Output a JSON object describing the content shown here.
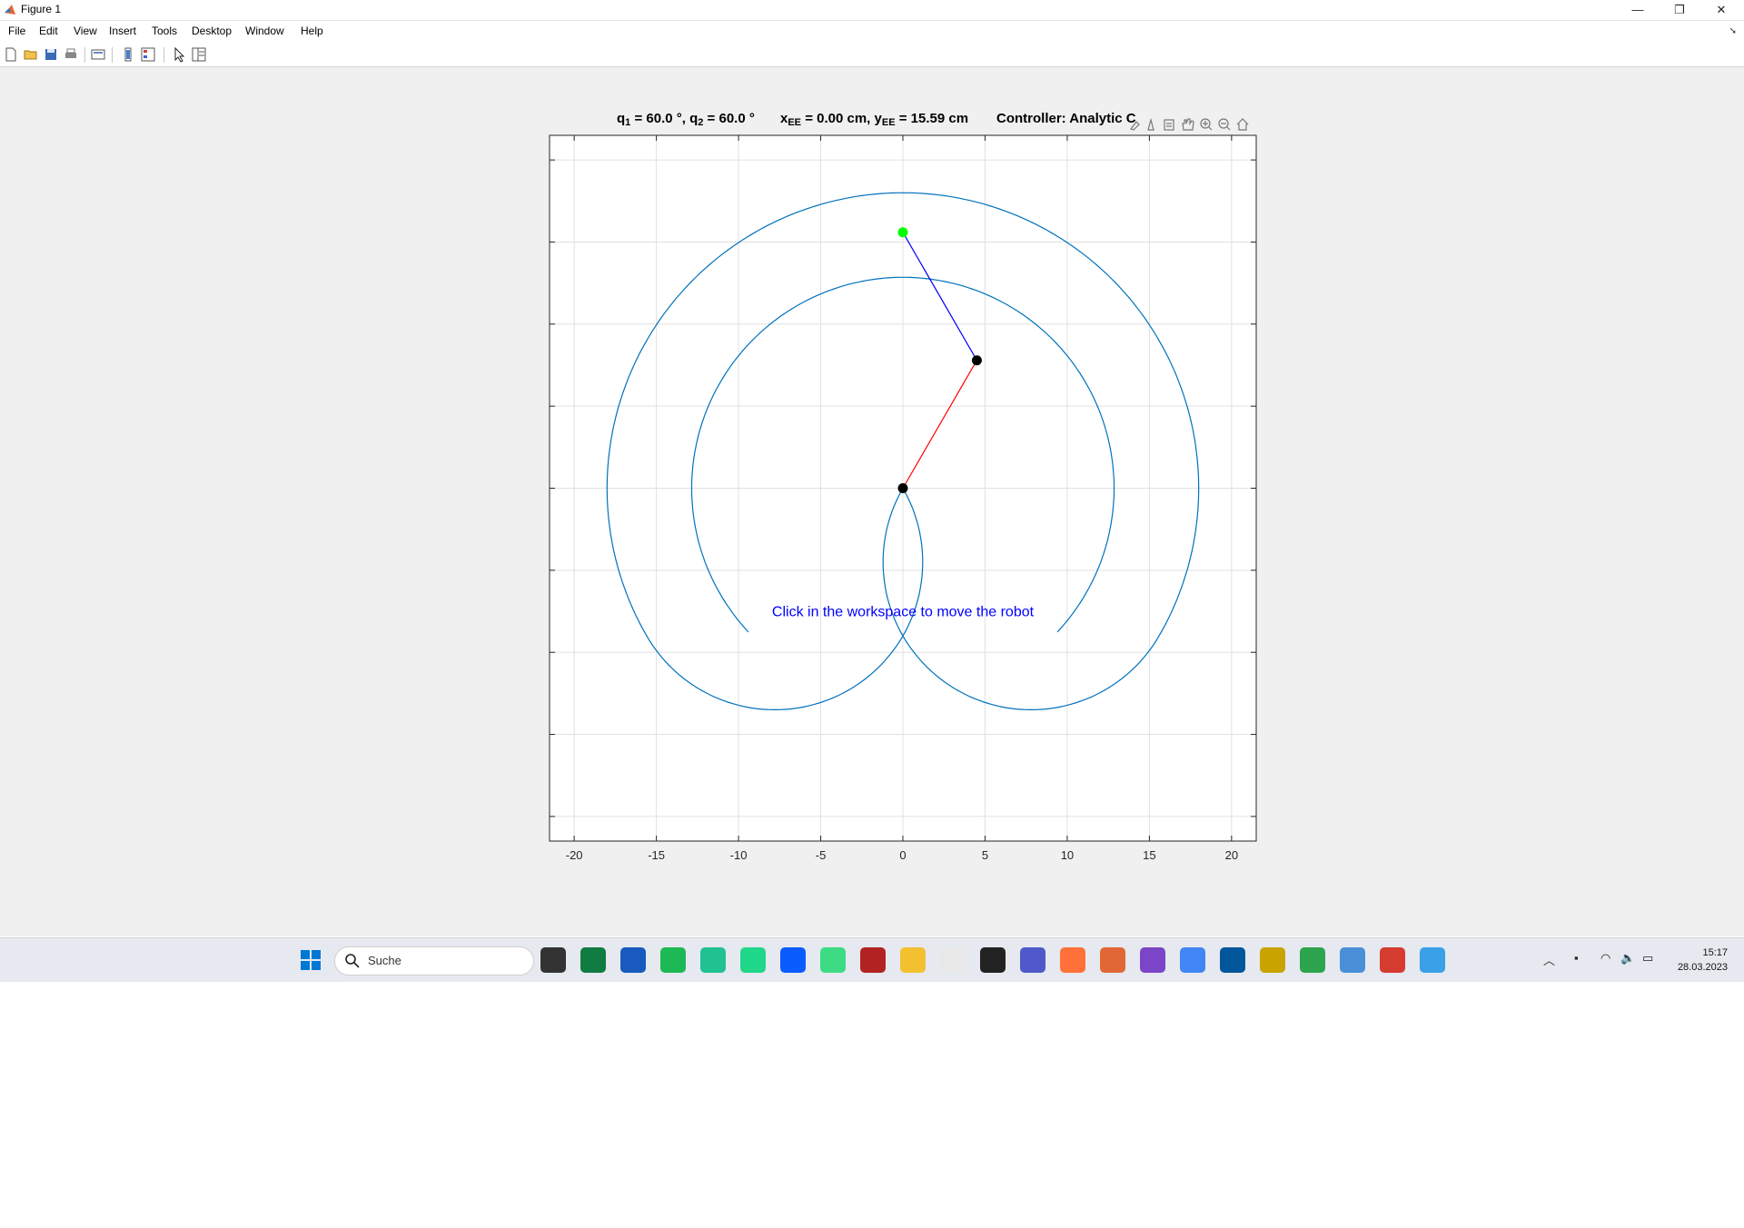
{
  "window": {
    "title": "Figure 1",
    "minimize_glyph": "—",
    "restore_glyph": "❐",
    "close_glyph": "✕"
  },
  "menu": [
    "File",
    "Edit",
    "View",
    "Insert",
    "Tools",
    "Desktop",
    "Window",
    "Help"
  ],
  "toolbar_icons": [
    "new-figure-icon",
    "open-file-icon",
    "save-icon",
    "print-icon",
    "print-preview-icon",
    "link-plot-icon",
    "insert-colorbar-icon",
    "pointer-icon",
    "property-inspector-icon"
  ],
  "axes_toolbar_icons": [
    "brush-icon",
    "data-tips-icon",
    "export-icon",
    "pan-icon",
    "zoom-in-icon",
    "zoom-out-icon",
    "home-icon"
  ],
  "plot": {
    "title_q": {
      "q1_label": "q",
      "q1_sub": "1",
      "q1_value": " = 60.0 °, ",
      "q2_label": "q",
      "q2_sub": "2",
      "q2_value": " = 60.0 °"
    },
    "title_ee": {
      "x_label": "x",
      "x_sub": "EE",
      "x_value": " = 0.00 cm, ",
      "y_label": "y",
      "y_sub": "EE",
      "y_value": " = 15.59 cm"
    },
    "title_controller": "Controller: Analytic C",
    "annotation": "Click in the workspace to move the robot",
    "annotation_color": "#0000ff"
  },
  "chart_data": {
    "type": "line",
    "xlim": [
      -21.5,
      21.5
    ],
    "ylim": [
      -21.5,
      21.5
    ],
    "xticks": [
      -20,
      -15,
      -10,
      -5,
      0,
      5,
      10,
      15,
      20
    ],
    "yticks": [
      -20,
      -15,
      -10,
      -5,
      0,
      5,
      10,
      15,
      20
    ],
    "grid": true,
    "workspace": {
      "outer_radius": 18,
      "inner_radius": 12.85,
      "outer_start_deg": -30,
      "outer_end_deg": 210,
      "color": "#0072bd"
    },
    "link1": {
      "from": [
        0,
        0
      ],
      "to": [
        4.5,
        7.79
      ],
      "color": "#ff0000"
    },
    "link2": {
      "from": [
        4.5,
        7.79
      ],
      "to": [
        0,
        15.59
      ],
      "color": "#0000ff"
    },
    "base_joint": [
      0,
      0
    ],
    "elbow_joint": [
      4.5,
      7.79
    ],
    "end_effector": [
      0,
      15.59
    ],
    "joint_color": "#000000",
    "end_effector_color": "#00ff00"
  },
  "taskbar": {
    "search_placeholder": "Suche",
    "apps": [
      "start-icon",
      "task-view-icon",
      "excel-icon",
      "word-icon",
      "spotify-icon",
      "clion-icon",
      "pycharm-icon",
      "zoom-icon",
      "android-studio-icon",
      "antivirus-icon",
      "file-explorer-icon",
      "matlab-alt-icon",
      "sourcetree-icon",
      "teams-icon",
      "firefox-icon",
      "matlab-icon",
      "clapperboard-icon",
      "chrome-icon",
      "flutter-icon",
      "java-icon",
      "xmind-icon",
      "monitor-icon",
      "xming-icon",
      "paint-icon"
    ],
    "app_colors": [
      "#0078d4",
      "#333333",
      "#107c41",
      "#185abd",
      "#1db954",
      "#21c292",
      "#21d789",
      "#0b5cff",
      "#3ddc84",
      "#b22222",
      "#f3c030",
      "#e8e8e8",
      "#222222",
      "#5059c9",
      "#ff7139",
      "#e16737",
      "#7b45c7",
      "#4285f4",
      "#02569b",
      "#c9a400",
      "#2ea44f",
      "#4a90d9",
      "#d63b2f",
      "#3aa0e8"
    ],
    "time": "15:17",
    "date": "28.03.2023"
  }
}
